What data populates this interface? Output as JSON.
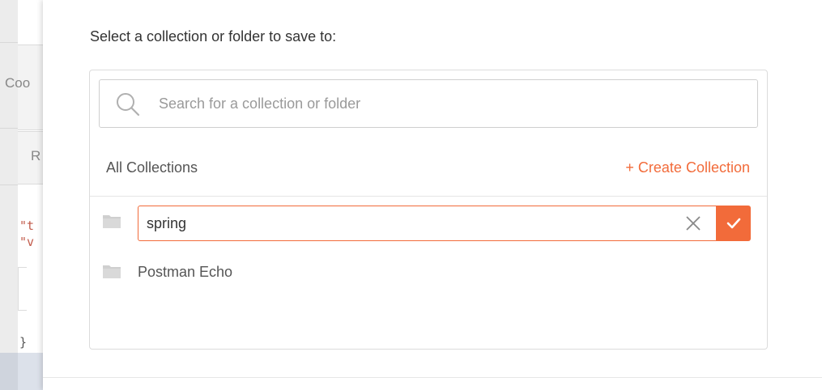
{
  "background": {
    "fragments": [
      "Coo",
      "R",
      "\"t",
      "\"v",
      "}"
    ]
  },
  "dialog": {
    "prompt": "Select a collection or folder to save to:",
    "search": {
      "placeholder": "Search for a collection or folder",
      "value": ""
    },
    "header": {
      "all_collections": "All Collections",
      "create_collection": "+ Create Collection"
    },
    "new_item": {
      "value": "spring",
      "clear_icon": "close-icon",
      "confirm_icon": "checkmark-icon"
    },
    "items": [
      {
        "label": "Postman Echo",
        "icon": "folder-icon"
      }
    ]
  },
  "colors": {
    "accent": "#f26b3a",
    "text": "#333333",
    "muted": "#9a9a9a",
    "border": "#dcdcdc"
  }
}
